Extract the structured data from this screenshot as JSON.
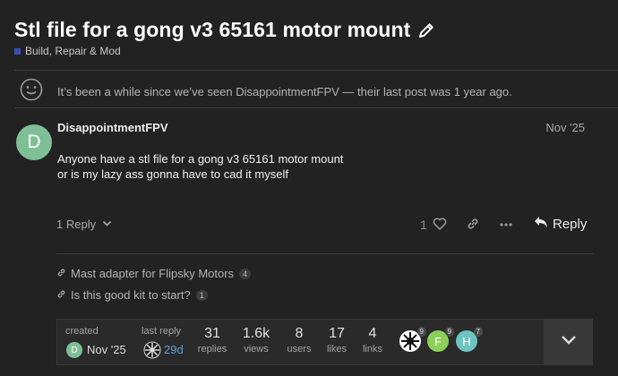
{
  "topic": {
    "title": "Stl file for a gong v3 65161 motor mount",
    "category": "Build, Repair & Mod",
    "category_color": "#3a4fb8"
  },
  "notice": {
    "text": "It’s been a while since we’ve seen DisappointmentFPV — their last post was 1 year ago."
  },
  "post": {
    "avatar_letter": "D",
    "avatar_color": "#7fbf97",
    "username": "DisappointmentFPV",
    "date": "Nov '25",
    "body_line1": "Anyone have a stl file for a gong v3 65161 motor mount",
    "body_line2": "or is my lazy ass gonna have to cad it myself",
    "replies_toggle": "1 Reply",
    "like_count": "1",
    "reply_label": "Reply"
  },
  "links": [
    {
      "text": "Mast adapter for Flipsky Motors",
      "count": "4"
    },
    {
      "text": "Is this good kit to start?",
      "count": "1"
    }
  ],
  "topic_map": {
    "created_label": "created",
    "created_avatar_letter": "D",
    "created_date": "Nov '25",
    "last_reply_label": "last reply",
    "last_reply_date": "29d",
    "stats": [
      {
        "value": "31",
        "label": "replies"
      },
      {
        "value": "1.6k",
        "label": "views"
      },
      {
        "value": "8",
        "label": "users"
      },
      {
        "value": "17",
        "label": "likes"
      },
      {
        "value": "4",
        "label": "links"
      }
    ],
    "participants": [
      {
        "letter": "",
        "count": "9",
        "color": "#111111"
      },
      {
        "letter": "F",
        "count": "9",
        "color": "#8ccf5a"
      },
      {
        "letter": "H",
        "count": "7",
        "color": "#6cc3c0"
      }
    ]
  }
}
